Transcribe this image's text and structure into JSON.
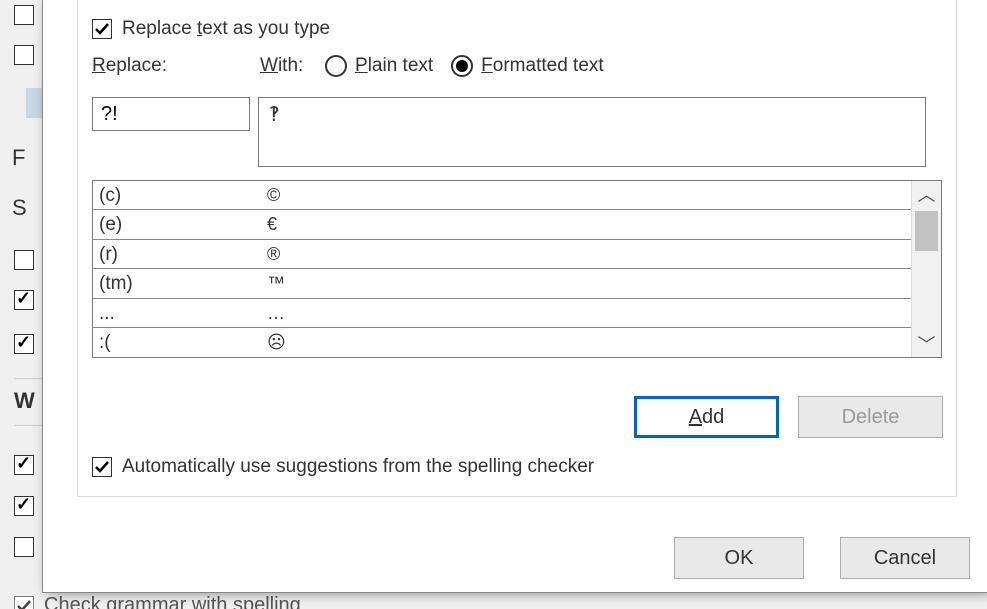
{
  "replace_as_you_type": {
    "checked": true,
    "label_pre": "Replace ",
    "label_u": "t",
    "label_post": "ext as you type"
  },
  "labels": {
    "replace_u": "R",
    "replace_post": "eplace:",
    "with_u": "W",
    "with_post": "ith:",
    "plain_u": "P",
    "plain_post": "lain text",
    "fmt_u": "F",
    "fmt_post": "ormatted text"
  },
  "radio_selected": "formatted",
  "replace_value": "?!",
  "with_value": "‽",
  "table_rows": [
    {
      "replace": "(c)",
      "with": "©"
    },
    {
      "replace": "(e)",
      "with": "€"
    },
    {
      "replace": "(r)",
      "with": "®"
    },
    {
      "replace": "(tm)",
      "with": "™"
    },
    {
      "replace": "...",
      "with": "…"
    },
    {
      "replace": ":(",
      "with": "☹"
    }
  ],
  "buttons": {
    "add_u": "A",
    "add_post": "dd",
    "delete": "Delete",
    "ok": "OK",
    "cancel": "Cancel"
  },
  "auto_suggest": {
    "checked": true,
    "label_pre": "Automatically use su",
    "label_u": "g",
    "label_post": "gestions from the spelling checker"
  },
  "bg": {
    "letter_F": "F",
    "letter_S": "S",
    "label_W": "W",
    "grammar_pre": "C",
    "grammar_post": "heck grammar with spelling"
  }
}
